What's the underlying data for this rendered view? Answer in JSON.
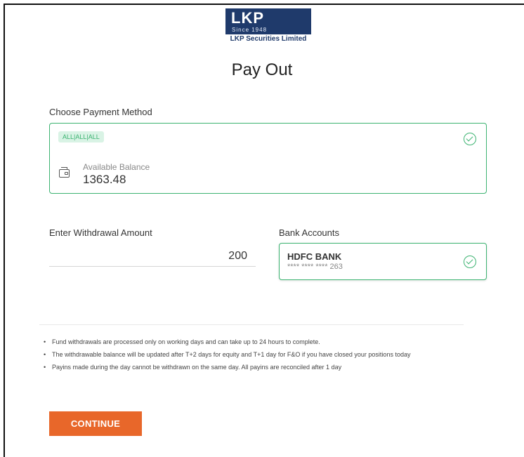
{
  "brand": {
    "logo_text": "LKP",
    "since": "Since 1948",
    "company": "LKP Securities Limited"
  },
  "page": {
    "title": "Pay Out"
  },
  "payment_method": {
    "label": "Choose Payment Method",
    "tag": "ALL|ALL|ALL",
    "balance_label": "Available Balance",
    "balance_value": "1363.48",
    "selected": true
  },
  "withdrawal": {
    "label": "Enter Withdrawal Amount",
    "value": "200"
  },
  "bank": {
    "label": "Bank Accounts",
    "name": "HDFC BANK",
    "masked_number": "**** **** **** 263",
    "selected": true
  },
  "notes": [
    "Fund withdrawals are processed only on working days and can take up to 24 hours to complete.",
    "The withdrawable balance will be updated after T+2 days for equity and T+1 day for F&O if you have closed your positions today",
    "Payins made during the day cannot be withdrawn on the same day. All payins are reconciled after 1 day"
  ],
  "actions": {
    "continue_label": "CONTINUE"
  },
  "colors": {
    "accent_green": "#3cb371",
    "brand_navy": "#1f3a6b",
    "button_orange": "#e8672a"
  }
}
